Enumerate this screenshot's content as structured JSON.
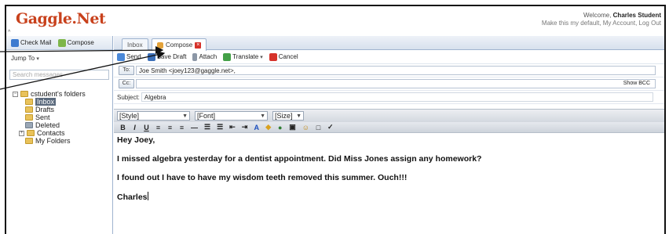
{
  "header": {
    "logo": "Gaggle.Net",
    "welcome_prefix": "Welcome, ",
    "user_name": "Charles Student",
    "links": "Make this my default, My Account, Log Out"
  },
  "left_panel": {
    "toolbar": {
      "check_mail": "Check Mail",
      "compose": "Compose"
    },
    "jump_to": "Jump To",
    "search_placeholder": "Search messages",
    "tree": {
      "root": "cstudent's folders",
      "inbox": "Inbox",
      "drafts": "Drafts",
      "sent": "Sent",
      "deleted": "Deleted",
      "contacts": "Contacts",
      "my_folders": "My Folders"
    }
  },
  "tabs": [
    {
      "label": "Inbox"
    },
    {
      "label": "Compose"
    }
  ],
  "actions": {
    "send": "Send",
    "save_draft": "Save Draft",
    "attach": "Attach",
    "translate": "Translate",
    "cancel": "Cancel"
  },
  "fields": {
    "to_label": "To:",
    "to_value": "Joe Smith <joey123@gaggle.net>,",
    "cc_label": "Cc:",
    "cc_value": "",
    "show_bcc": "Show BCC",
    "subject_label": "Subject:",
    "subject_value": "Algebra"
  },
  "format": {
    "style": "[Style]",
    "font": "[Font]",
    "size": "[Size]"
  },
  "message": {
    "greeting": "Hey Joey,",
    "line1": "I missed algebra yesterday for a dentist appointment. Did Miss Jones assign any homework?",
    "line2": "I found out I have to have my wisdom teeth removed this summer. Ouch!!!",
    "signature": "Charles"
  },
  "colors": {
    "logo": "#c8411c",
    "accent_border": "#9fb4cf",
    "cancel_red": "#d6322a"
  }
}
